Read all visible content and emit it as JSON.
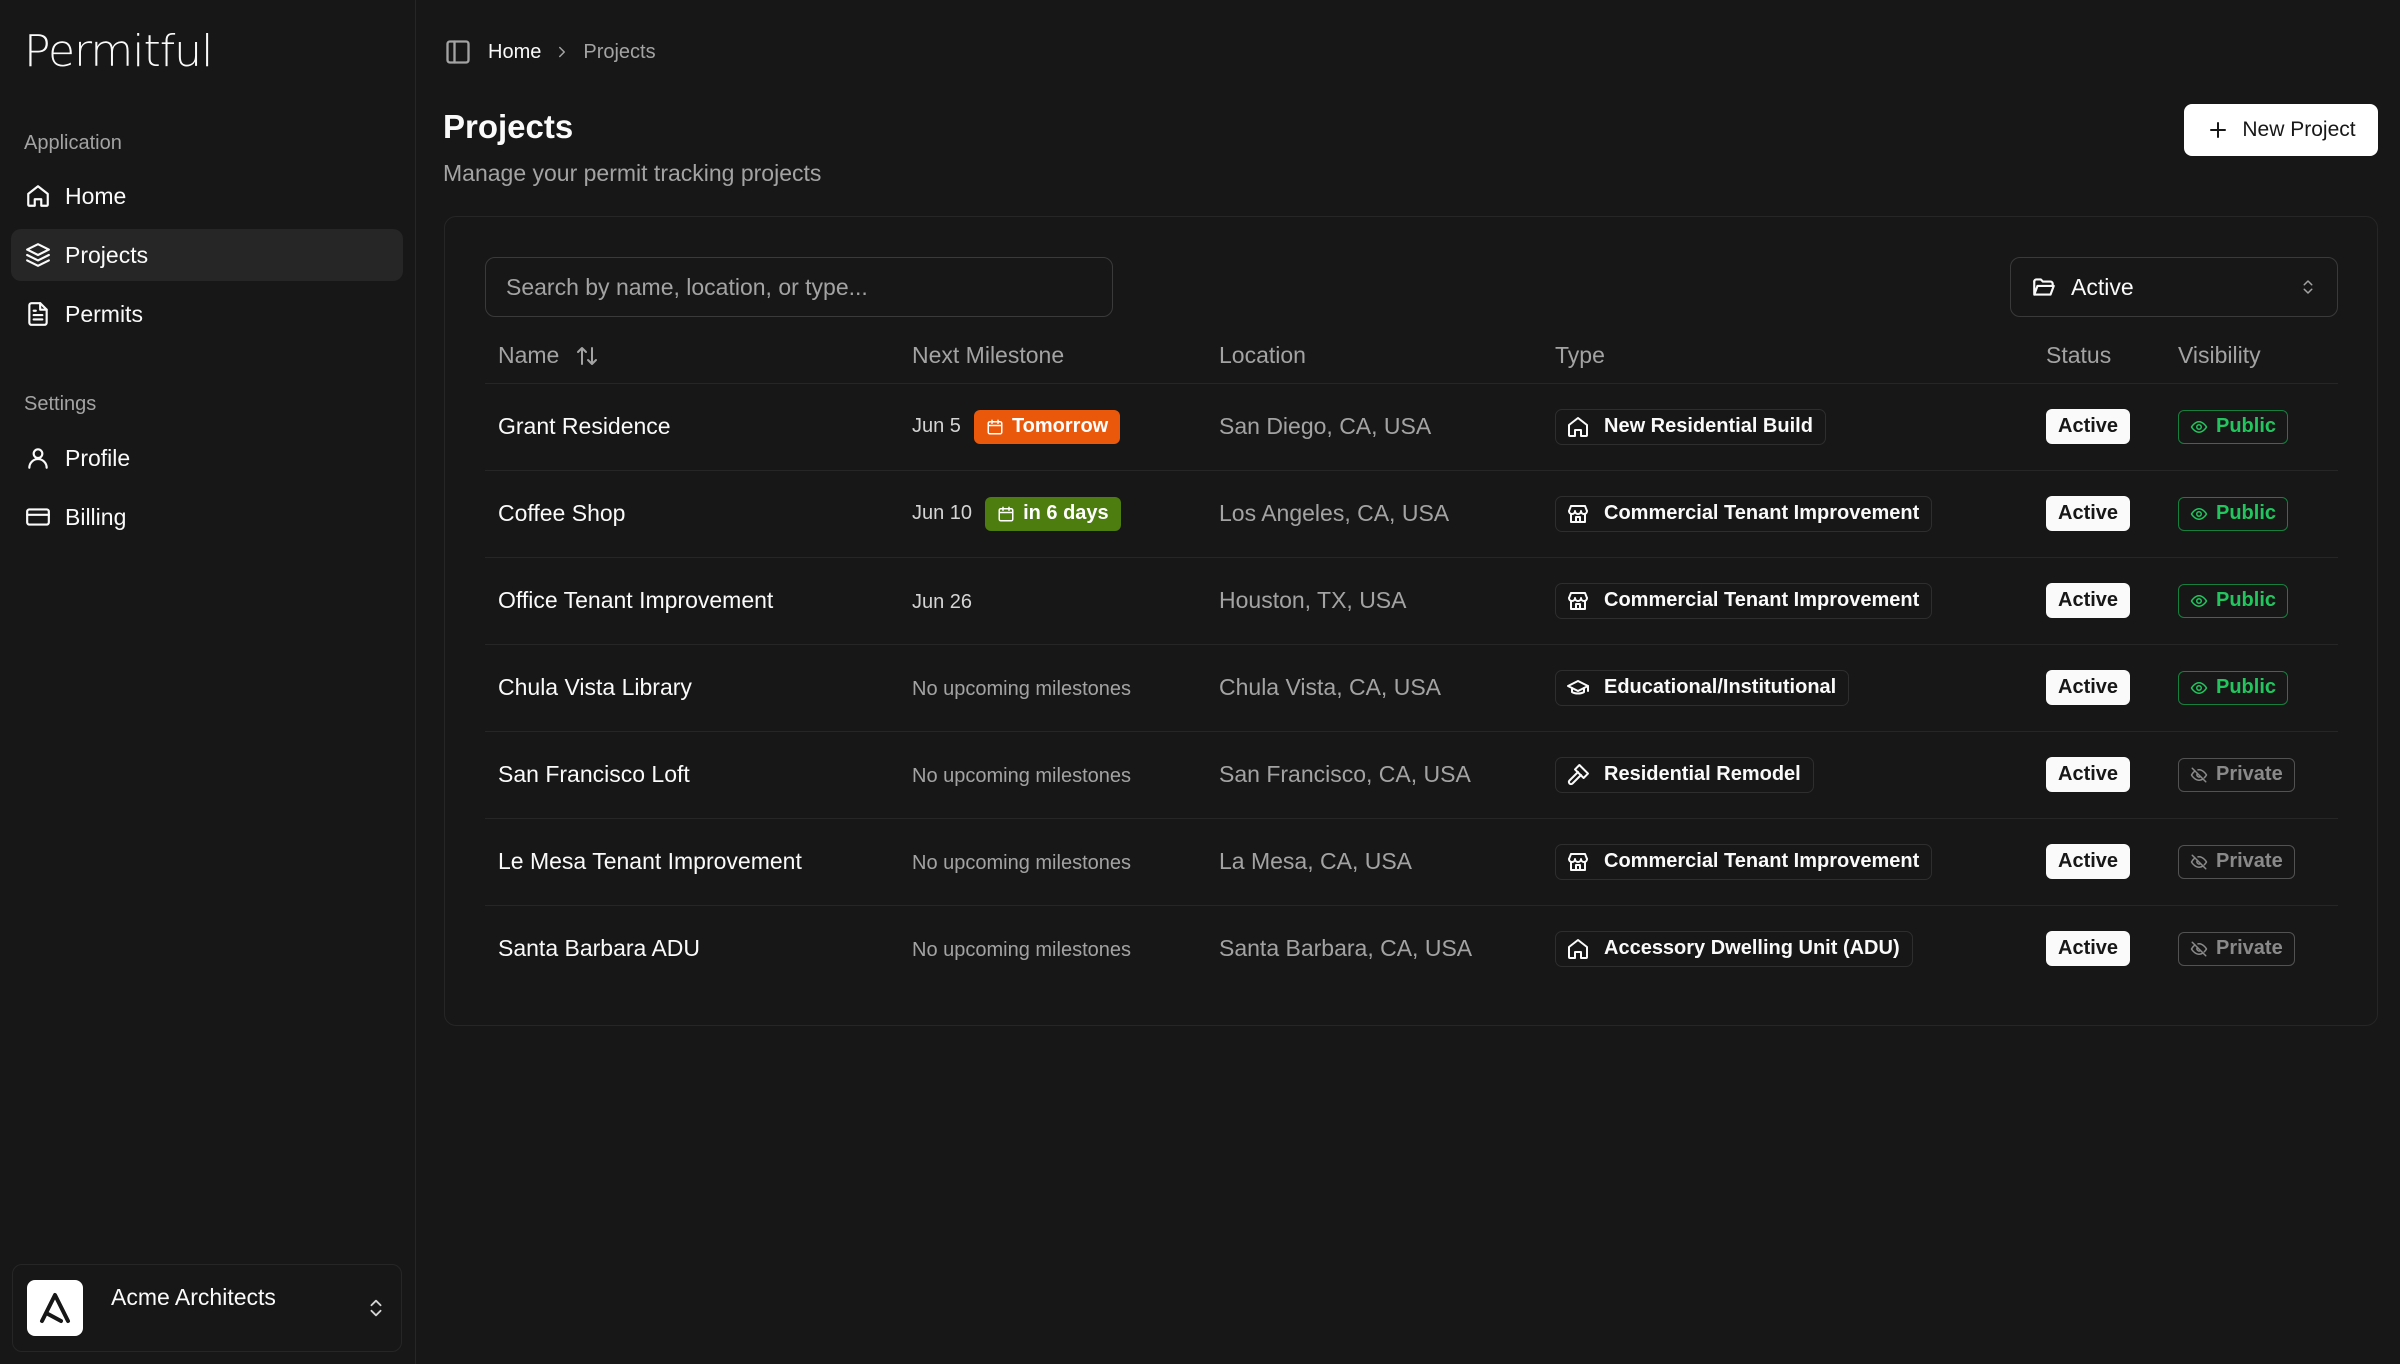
{
  "app": {
    "name": "Permitful"
  },
  "sidebar": {
    "groups": [
      {
        "label": "Application",
        "items": [
          {
            "label": "Home",
            "icon": "home-icon"
          },
          {
            "label": "Projects",
            "icon": "layers-icon",
            "active": true
          },
          {
            "label": "Permits",
            "icon": "document-icon"
          }
        ]
      },
      {
        "label": "Settings",
        "items": [
          {
            "label": "Profile",
            "icon": "user-icon"
          },
          {
            "label": "Billing",
            "icon": "credit-card-icon"
          }
        ]
      }
    ],
    "org": {
      "name": "Acme Architects"
    }
  },
  "breadcrumb": {
    "home": "Home",
    "current": "Projects"
  },
  "page": {
    "title": "Projects",
    "subtitle": "Manage your permit tracking projects",
    "new_button": "New Project"
  },
  "search": {
    "placeholder": "Search by name, location, or type..."
  },
  "status_filter": {
    "value": "Active"
  },
  "table": {
    "columns": [
      "Name",
      "Next Milestone",
      "Location",
      "Type",
      "Status",
      "Visibility"
    ],
    "rows": [
      {
        "name": "Grant Residence",
        "milestone_date": "Jun 5",
        "milestone_badge": "Tomorrow",
        "badge_color": "#ea580c",
        "location": "San Diego, CA, USA",
        "type": "New Residential Build",
        "type_icon": "house-icon",
        "status": "Active",
        "visibility": "Public"
      },
      {
        "name": "Coffee Shop",
        "milestone_date": "Jun 10",
        "milestone_badge": "in 6 days",
        "badge_color": "#4d7c0f",
        "location": "Los Angeles, CA, USA",
        "type": "Commercial Tenant Improvement",
        "type_icon": "store-icon",
        "status": "Active",
        "visibility": "Public"
      },
      {
        "name": "Office Tenant Improvement",
        "milestone_date": "Jun 26",
        "location": "Houston, TX, USA",
        "type": "Commercial Tenant Improvement",
        "type_icon": "store-icon",
        "status": "Active",
        "visibility": "Public"
      },
      {
        "name": "Chula Vista Library",
        "milestone_text": "No upcoming milestones",
        "location": "Chula Vista, CA, USA",
        "type": "Educational/Institutional",
        "type_icon": "graduation-cap-icon",
        "status": "Active",
        "visibility": "Public"
      },
      {
        "name": "San Francisco Loft",
        "milestone_text": "No upcoming milestones",
        "location": "San Francisco, CA, USA",
        "type": "Residential Remodel",
        "type_icon": "hammer-icon",
        "status": "Active",
        "visibility": "Private"
      },
      {
        "name": "Le Mesa Tenant Improvement",
        "milestone_text": "No upcoming milestones",
        "location": "La Mesa, CA, USA",
        "type": "Commercial Tenant Improvement",
        "type_icon": "store-icon",
        "status": "Active",
        "visibility": "Private"
      },
      {
        "name": "Santa Barbara ADU",
        "milestone_text": "No upcoming milestones",
        "location": "Santa Barbara, CA, USA",
        "type": "Accessory Dwelling Unit (ADU)",
        "type_icon": "house-icon",
        "status": "Active",
        "visibility": "Private"
      }
    ]
  }
}
